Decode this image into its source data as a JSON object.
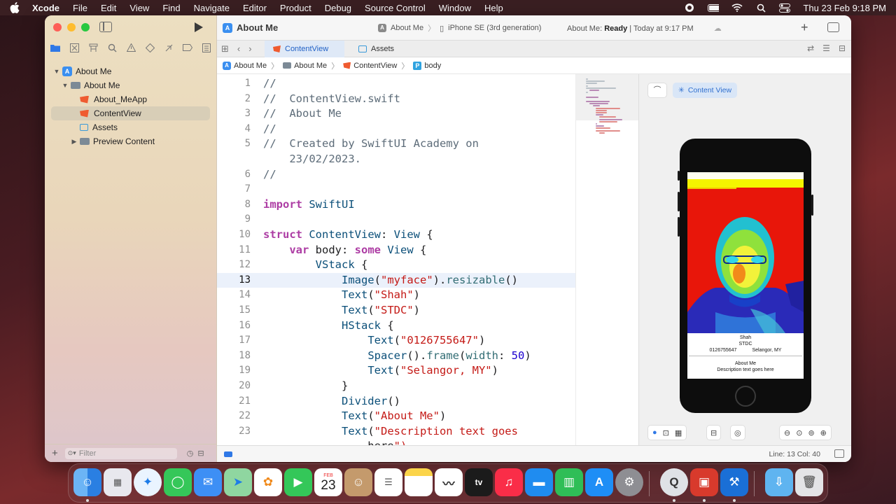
{
  "menubar": {
    "app_name": "Xcode",
    "items": [
      "File",
      "Edit",
      "View",
      "Find",
      "Navigate",
      "Editor",
      "Product",
      "Debug",
      "Source Control",
      "Window",
      "Help"
    ],
    "clock": "Thu 23 Feb  9:18 PM"
  },
  "toolbar": {
    "project_title": "About Me",
    "scheme_target": "About Me",
    "scheme_device": "iPhone SE (3rd generation)",
    "activity_prefix": "About Me:",
    "activity_state": "Ready",
    "activity_time": "| Today at 9:17 PM"
  },
  "tabs": [
    {
      "label": "ContentView",
      "active": true
    },
    {
      "label": "Assets",
      "active": false
    }
  ],
  "breadcrumb": [
    "About Me",
    "About Me",
    "ContentView",
    "body"
  ],
  "navigator": {
    "items": [
      {
        "label": "About Me",
        "level": 0,
        "disclosure": "open",
        "icon": "app-project-icon"
      },
      {
        "label": "About Me",
        "level": 1,
        "disclosure": "open",
        "icon": "folder-icon"
      },
      {
        "label": "About_MeApp",
        "level": 2,
        "disclosure": "none",
        "icon": "swift-file-icon"
      },
      {
        "label": "ContentView",
        "level": 2,
        "disclosure": "none",
        "icon": "swift-file-icon",
        "selected": true
      },
      {
        "label": "Assets",
        "level": 2,
        "disclosure": "none",
        "icon": "asset-catalog-icon"
      },
      {
        "label": "Preview Content",
        "level": 2,
        "disclosure": "closed",
        "icon": "folder-icon"
      }
    ],
    "filter_placeholder": "Filter"
  },
  "code": {
    "current_line": 13,
    "lines": [
      {
        "n": "1",
        "t": "//"
      },
      {
        "n": "2",
        "t": "//  ContentView.swift"
      },
      {
        "n": "3",
        "t": "//  About Me"
      },
      {
        "n": "4",
        "t": "//"
      },
      {
        "n": "5",
        "t": "//  Created by SwiftUI Academy on"
      },
      {
        "n": "",
        "t": "    23/02/2023."
      },
      {
        "n": "6",
        "t": "//"
      },
      {
        "n": "7",
        "t": ""
      },
      {
        "n": "8",
        "t": "import SwiftUI"
      },
      {
        "n": "9",
        "t": ""
      },
      {
        "n": "10",
        "t": "struct ContentView: View {"
      },
      {
        "n": "11",
        "t": "    var body: some View {"
      },
      {
        "n": "12",
        "t": "        VStack {"
      },
      {
        "n": "13",
        "t": "            Image(\"myface\").resizable()"
      },
      {
        "n": "14",
        "t": "            Text(\"Shah\")"
      },
      {
        "n": "15",
        "t": "            Text(\"STDC\")"
      },
      {
        "n": "16",
        "t": "            HStack {"
      },
      {
        "n": "17",
        "t": "                Text(\"0126755647\")"
      },
      {
        "n": "18",
        "t": "                Spacer().frame(width: 50)"
      },
      {
        "n": "19",
        "t": "                Text(\"Selangor, MY\")"
      },
      {
        "n": "20",
        "t": "            }"
      },
      {
        "n": "21",
        "t": "            Divider()"
      },
      {
        "n": "22",
        "t": "            Text(\"About Me\")"
      },
      {
        "n": "23",
        "t": "            Text(\"Description text goes"
      },
      {
        "n": "",
        "t": "                here\")"
      }
    ]
  },
  "canvas": {
    "pin_label": "⌒",
    "preview_button": "Content View",
    "preview": {
      "name": "Shah",
      "org": "STDC",
      "phone": "0126755647",
      "location": "Selangor, MY",
      "heading": "About Me",
      "description": "Description text goes here"
    }
  },
  "statusbar": {
    "line_col": "Line: 13  Col: 40"
  },
  "dock": {
    "apps": [
      "Finder",
      "Launchpad",
      "Safari",
      "Messages",
      "Mail",
      "Maps",
      "Photos",
      "FaceTime",
      "Calendar",
      "Contacts",
      "Reminders",
      "Notes",
      "Freeform",
      "TV",
      "Music",
      "Keynote",
      "Numbers",
      "App Store",
      "System Settings",
      "QuickTime Player",
      "Photo Booth",
      "Xcode",
      "Downloads",
      "Trash"
    ],
    "calendar_month": "FEB",
    "calendar_day": "23"
  },
  "colors": {
    "accent": "#2f78e6",
    "keyword": "#ad3da4",
    "string": "#c41a16",
    "comment": "#5d6c79",
    "type": "#0b4f79",
    "number": "#1c00cf"
  }
}
